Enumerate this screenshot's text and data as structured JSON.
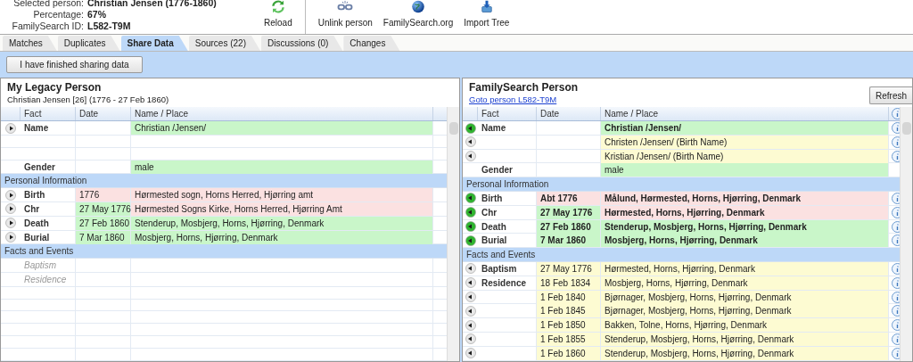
{
  "person_info": [
    {
      "label": "Selected person:",
      "value": "Christian Jensen (1776-1860)"
    },
    {
      "label": "Percentage:",
      "value": "67%"
    },
    {
      "label": "FamilySearch ID:",
      "value": "L582-T9M"
    }
  ],
  "toolbar": [
    {
      "kind": "reload",
      "label": "Reload"
    },
    {
      "kind": "unlink",
      "label": "Unlink person"
    },
    {
      "kind": "globe",
      "label": "FamilySearch.org"
    },
    {
      "kind": "import",
      "label": "Import Tree"
    }
  ],
  "tabs": [
    {
      "label": "Matches",
      "selected": false
    },
    {
      "label": "Duplicates",
      "selected": false
    },
    {
      "label": "Share Data",
      "selected": true
    },
    {
      "label": "Sources (22)",
      "selected": false
    },
    {
      "label": "Discussions (0)",
      "selected": false
    },
    {
      "label": "Changes",
      "selected": false
    }
  ],
  "finish_button": "I have finished sharing data",
  "left_panel": {
    "title": "My Legacy Person",
    "subtitle": "Christian Jensen [26] (1776 - 27 Feb 1860)",
    "columns": [
      "Fact",
      "Date",
      "Name / Place"
    ],
    "rows": [
      {
        "kind": "fact",
        "arrow": {
          "color": "#e8e8e8"
        },
        "fact": "Name",
        "place": {
          "text": "Christian /Jensen/",
          "color": "#c9f6c9"
        },
        "bold": false
      },
      {
        "kind": "blank"
      },
      {
        "kind": "blank"
      },
      {
        "kind": "fact",
        "fact": "Gender",
        "place": {
          "text": "male",
          "color": "#c9f6c9"
        },
        "bold": false
      },
      {
        "kind": "section",
        "label": "Personal Information"
      },
      {
        "kind": "fact",
        "arrow": {
          "color": "#e8e8e8"
        },
        "fact": "Birth",
        "date": {
          "text": "1776",
          "color": "#fbe1e1"
        },
        "place": {
          "text": "Hørmested sogn, Horns Herred, Hjørring amt",
          "color": "#fbe1e1"
        },
        "bold": false
      },
      {
        "kind": "fact",
        "arrow": {
          "color": "#e8e8e8"
        },
        "fact": "Chr",
        "date": {
          "text": "27 May 1776",
          "color": "#c9f6c9"
        },
        "place": {
          "text": "Hørmested Sogns Kirke, Horns Herred, Hjørring Amt",
          "color": "#fbe1e1"
        },
        "bold": false
      },
      {
        "kind": "fact",
        "arrow": {
          "color": "#e8e8e8"
        },
        "fact": "Death",
        "date": {
          "text": "27 Feb 1860",
          "color": "#c9f6c9"
        },
        "place": {
          "text": "Stenderup, Mosbjerg, Horns, Hjørring, Denmark",
          "color": "#c9f6c9"
        },
        "bold": false
      },
      {
        "kind": "fact",
        "arrow": {
          "color": "#e8e8e8"
        },
        "fact": "Burial",
        "date": {
          "text": "7 Mar 1860",
          "color": "#c9f6c9"
        },
        "place": {
          "text": "Mosbjerg, Horns, Hjørring, Denmark",
          "color": "#c9f6c9"
        },
        "bold": false
      },
      {
        "kind": "section",
        "label": "Facts and Events"
      },
      {
        "kind": "placeholder",
        "fact": "Baptism"
      },
      {
        "kind": "placeholder",
        "fact": "Residence"
      }
    ]
  },
  "right_panel": {
    "title": "FamilySearch Person",
    "link": "Goto person L582-T9M",
    "refresh_button": "Refresh",
    "columns": [
      "Fact",
      "Date",
      "Name / Place"
    ],
    "rows": [
      {
        "kind": "fact",
        "arrow": {
          "color": "#2fb52f"
        },
        "fact": "Name",
        "place": {
          "text": "Christian /Jensen/",
          "color": "#c9f6c9"
        },
        "bold": true,
        "info": true
      },
      {
        "kind": "fact",
        "arrow": {
          "color": "#e8e8e8"
        },
        "place": {
          "text": "Christen /Jensen/ (Birth Name)",
          "color": "#fdfbd2"
        },
        "bold": false,
        "info": true
      },
      {
        "kind": "fact",
        "arrow": {
          "color": "#e8e8e8"
        },
        "place": {
          "text": "Kristian /Jensen/ (Birth Name)",
          "color": "#fdfbd2"
        },
        "bold": false,
        "info": true
      },
      {
        "kind": "fact",
        "fact": "Gender",
        "place": {
          "text": "male",
          "color": "#c9f6c9"
        },
        "bold": false,
        "info": false
      },
      {
        "kind": "section",
        "label": "Personal Information"
      },
      {
        "kind": "fact",
        "arrow": {
          "color": "#2fb52f"
        },
        "fact": "Birth",
        "date": {
          "text": "Abt 1776",
          "color": "#fbe1e1"
        },
        "place": {
          "text": "Målund, Hørmested, Horns, Hjørring, Denmark",
          "color": "#fbe1e1"
        },
        "bold": true,
        "info": true
      },
      {
        "kind": "fact",
        "arrow": {
          "color": "#2fb52f"
        },
        "fact": "Chr",
        "date": {
          "text": "27 May 1776",
          "color": "#c9f6c9"
        },
        "place": {
          "text": "Hørmested, Horns, Hjørring, Denmark",
          "color": "#fbe1e1"
        },
        "bold": true,
        "info": true
      },
      {
        "kind": "fact",
        "arrow": {
          "color": "#2fb52f"
        },
        "fact": "Death",
        "date": {
          "text": "27 Feb 1860",
          "color": "#c9f6c9"
        },
        "place": {
          "text": "Stenderup, Mosbjerg, Horns, Hjørring, Denmark",
          "color": "#c9f6c9"
        },
        "bold": true,
        "info": true
      },
      {
        "kind": "fact",
        "arrow": {
          "color": "#2fb52f"
        },
        "fact": "Burial",
        "date": {
          "text": "7 Mar 1860",
          "color": "#c9f6c9"
        },
        "place": {
          "text": "Mosbjerg, Horns, Hjørring, Denmark",
          "color": "#c9f6c9"
        },
        "bold": true,
        "info": true
      },
      {
        "kind": "section",
        "label": "Facts and Events"
      },
      {
        "kind": "fact",
        "arrow": {
          "color": "#e8e8e8"
        },
        "fact": "Baptism",
        "date": {
          "text": "27 May 1776",
          "color": "#fdfbd2"
        },
        "place": {
          "text": "Hørmested, Horns, Hjørring, Denmark",
          "color": "#fdfbd2"
        },
        "bold": false,
        "info": true
      },
      {
        "kind": "fact",
        "arrow": {
          "color": "#e8e8e8"
        },
        "fact": "Residence",
        "date": {
          "text": "18 Feb 1834",
          "color": "#fdfbd2"
        },
        "place": {
          "text": "Mosbjerg, Horns, Hjørring, Denmark",
          "color": "#fdfbd2"
        },
        "bold": false,
        "info": true
      },
      {
        "kind": "fact",
        "arrow": {
          "color": "#e8e8e8"
        },
        "date": {
          "text": "1 Feb 1840",
          "color": "#fdfbd2"
        },
        "place": {
          "text": "Bjørnager, Mosbjerg, Horns, Hjørring, Denmark",
          "color": "#fdfbd2"
        },
        "bold": false,
        "info": true
      },
      {
        "kind": "fact",
        "arrow": {
          "color": "#e8e8e8"
        },
        "date": {
          "text": "1 Feb 1845",
          "color": "#fdfbd2"
        },
        "place": {
          "text": "Bjørnager, Mosbjerg, Horns, Hjørring, Denmark",
          "color": "#fdfbd2"
        },
        "bold": false,
        "info": true
      },
      {
        "kind": "fact",
        "arrow": {
          "color": "#e8e8e8"
        },
        "date": {
          "text": "1 Feb 1850",
          "color": "#fdfbd2"
        },
        "place": {
          "text": "Bakken, Tolne, Horns, Hjørring, Denmark",
          "color": "#fdfbd2"
        },
        "bold": false,
        "info": true
      },
      {
        "kind": "fact",
        "arrow": {
          "color": "#e8e8e8"
        },
        "date": {
          "text": "1 Feb 1855",
          "color": "#fdfbd2"
        },
        "place": {
          "text": "Stenderup, Mosbjerg, Horns, Hjørring, Denmark",
          "color": "#fdfbd2"
        },
        "bold": false,
        "info": true
      },
      {
        "kind": "fact",
        "arrow": {
          "color": "#e8e8e8"
        },
        "date": {
          "text": "1 Feb 1860",
          "color": "#fdfbd2"
        },
        "place": {
          "text": "Stenderup, Mosbjerg, Horns, Hjørring, Denmark",
          "color": "#fdfbd2"
        },
        "bold": false,
        "info": true
      }
    ]
  }
}
